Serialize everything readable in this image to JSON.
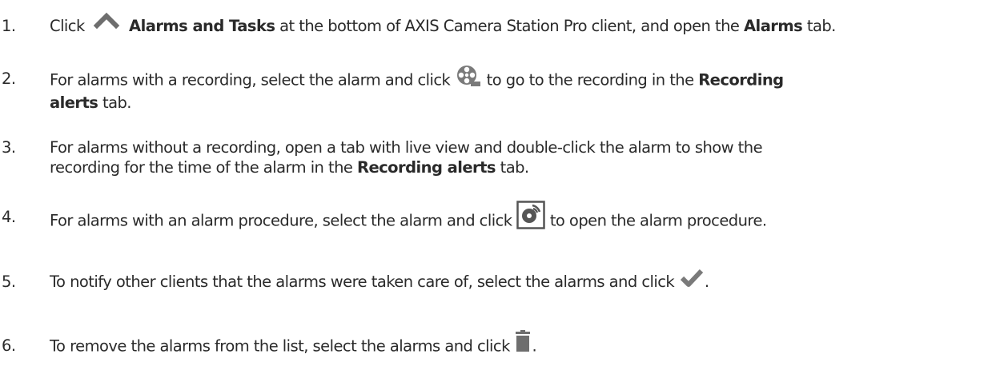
{
  "steps": [
    {
      "number": "1.",
      "text_1": "Click",
      "bold_1": "Alarms and Tasks",
      "text_2": "at the bottom of AXIS Camera Station Pro client, and open the",
      "bold_2": "Alarms",
      "text_3": "tab.",
      "icon": "chevron-up-icon"
    },
    {
      "number": "2.",
      "text_1": "For alarms with a recording, select the alarm and click",
      "text_2": "to go to the recording in the",
      "bold_1": "Recording",
      "bold_2": "alerts",
      "text_3": "tab.",
      "icon": "film-reel-icon"
    },
    {
      "number": "3.",
      "line_1": "For alarms without a recording, open a tab with live view and double-click the alarm to show the",
      "text_1": "recording for the time of the alarm in the",
      "bold_1": "Recording alerts",
      "text_2": "tab."
    },
    {
      "number": "4.",
      "text_1": "For alarms with an alarm procedure, select the alarm and click",
      "text_2": "to open the alarm procedure.",
      "icon": "alarm-procedure-icon"
    },
    {
      "number": "5.",
      "text_1": "To notify other clients that the alarms were taken care of, select the alarms and click",
      "text_2": ".",
      "icon": "checkmark-icon"
    },
    {
      "number": "6.",
      "text_1": "To remove the alarms from the list, select the alarms and click",
      "text_2": ".",
      "icon": "trash-icon"
    }
  ],
  "colors": {
    "text": "#2a2a2a",
    "icon_gray": "#7a7a7a",
    "icon_dark": "#555555"
  }
}
